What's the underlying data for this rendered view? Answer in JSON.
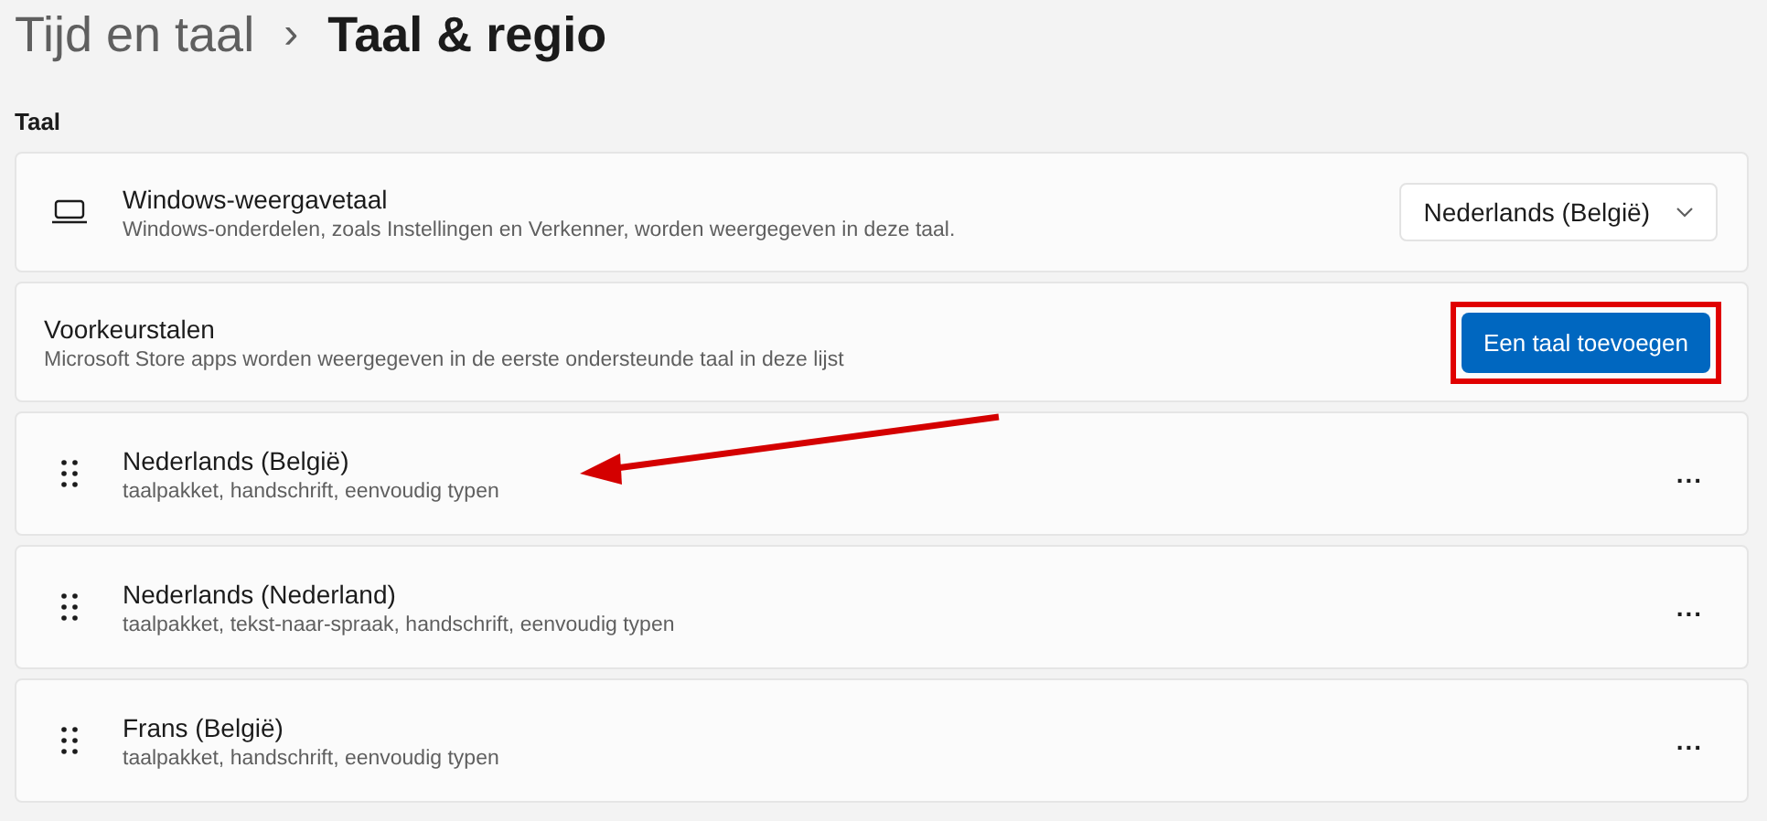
{
  "breadcrumb": {
    "parent": "Tijd en taal",
    "separator": "›",
    "current": "Taal & regio"
  },
  "section_label": "Taal",
  "display_language": {
    "title": "Windows-weergavetaal",
    "description": "Windows-onderdelen, zoals Instellingen en Verkenner, worden weergegeven in deze taal.",
    "dropdown_value": "Nederlands (België)"
  },
  "preferred_languages": {
    "title": "Voorkeurstalen",
    "description": "Microsoft Store apps worden weergegeven in de eerste ondersteunde taal in deze lijst",
    "add_button": "Een taal toevoegen",
    "highlighted": true
  },
  "languages": [
    {
      "name": "Nederlands (België)",
      "features": "taalpakket, handschrift, eenvoudig typen",
      "more": "...",
      "pointed_at": true
    },
    {
      "name": "Nederlands (Nederland)",
      "features": "taalpakket, tekst-naar-spraak, handschrift, eenvoudig typen",
      "more": "...",
      "pointed_at": false
    },
    {
      "name": "Frans (België)",
      "features": "taalpakket, handschrift, eenvoudig typen",
      "more": "...",
      "pointed_at": false
    }
  ]
}
